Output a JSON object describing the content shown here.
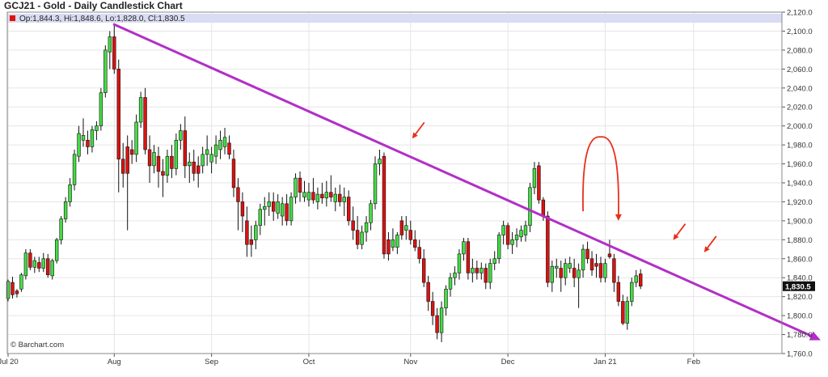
{
  "chart_data": {
    "type": "candlestick",
    "title": "GCJ21 - Gold - Daily Candlestick Chart",
    "ohlc": {
      "label": "Op:1,844.3, Hi:1,848.6, Lo:1,828.0, Cl:1,830.5"
    },
    "watermark": "© Barchart.com",
    "last_price_label": "1,830.5",
    "y_axis": {
      "min": 1760,
      "max": 2120,
      "tick_labels": [
        "2,120.0",
        "2,100.0",
        "2,080.0",
        "2,060.0",
        "2,040.0",
        "2,020.0",
        "2,000.0",
        "1,980.0",
        "1,960.0",
        "1,940.0",
        "1,920.0",
        "1,900.0",
        "1,880.0",
        "1,860.0",
        "1,840.0",
        "1,820.0",
        "1,800.0",
        "1,780.0",
        "1,760.0"
      ],
      "ticks": [
        2120,
        2100,
        2080,
        2060,
        2040,
        2020,
        2000,
        1980,
        1960,
        1940,
        1920,
        1900,
        1880,
        1860,
        1840,
        1820,
        1800,
        1780,
        1760
      ]
    },
    "x_axis": {
      "labels": [
        {
          "text": "Jul 20",
          "bar": 0
        },
        {
          "text": "Aug",
          "bar": 24
        },
        {
          "text": "Sep",
          "bar": 46
        },
        {
          "text": "Oct",
          "bar": 68
        },
        {
          "text": "Nov",
          "bar": 91
        },
        {
          "text": "Dec",
          "bar": 113
        },
        {
          "text": "Jan 21",
          "bar": 135
        },
        {
          "text": "Feb",
          "bar": 155
        }
      ]
    },
    "candles": [
      [
        1,
        1818,
        1838,
        1815,
        1836
      ],
      [
        0,
        1835,
        1841,
        1818,
        1822
      ],
      [
        0,
        1823,
        1828,
        1819,
        1826
      ],
      [
        1,
        1828,
        1845,
        1825,
        1843
      ],
      [
        1,
        1842,
        1870,
        1838,
        1866
      ],
      [
        0,
        1866,
        1870,
        1848,
        1851
      ],
      [
        1,
        1851,
        1862,
        1845,
        1858
      ],
      [
        0,
        1856,
        1862,
        1846,
        1850
      ],
      [
        1,
        1850,
        1866,
        1846,
        1860
      ],
      [
        0,
        1860,
        1865,
        1840,
        1843
      ],
      [
        1,
        1842,
        1860,
        1838,
        1858
      ],
      [
        1,
        1858,
        1882,
        1855,
        1880
      ],
      [
        1,
        1880,
        1905,
        1875,
        1902
      ],
      [
        1,
        1902,
        1925,
        1898,
        1920
      ],
      [
        1,
        1920,
        1945,
        1915,
        1938
      ],
      [
        1,
        1938,
        1975,
        1932,
        1970
      ],
      [
        1,
        1968,
        2000,
        1962,
        1992
      ],
      [
        1,
        1990,
        2008,
        1978,
        1985
      ],
      [
        0,
        1985,
        1995,
        1970,
        1978
      ],
      [
        1,
        1978,
        2000,
        1972,
        1996
      ],
      [
        1,
        1995,
        2005,
        1985,
        2000
      ],
      [
        1,
        2000,
        2040,
        1995,
        2035
      ],
      [
        1,
        2035,
        2085,
        2030,
        2080
      ],
      [
        1,
        2078,
        2100,
        2060,
        2094
      ],
      [
        0,
        2094,
        2108,
        2055,
        2060
      ],
      [
        0,
        2060,
        2070,
        1930,
        1965
      ],
      [
        0,
        1965,
        1982,
        1935,
        1950
      ],
      [
        0,
        1950,
        1990,
        1890,
        1978
      ],
      [
        0,
        1975,
        1985,
        1960,
        1970
      ],
      [
        1,
        1970,
        2012,
        1962,
        2004
      ],
      [
        1,
        2004,
        2036,
        1998,
        2030
      ],
      [
        0,
        2030,
        2040,
        1970,
        1975
      ],
      [
        0,
        1975,
        1990,
        1940,
        1958
      ],
      [
        1,
        1958,
        1980,
        1950,
        1972
      ],
      [
        0,
        1968,
        1978,
        1935,
        1952
      ],
      [
        0,
        1952,
        1965,
        1925,
        1948
      ],
      [
        1,
        1948,
        1975,
        1940,
        1968
      ],
      [
        0,
        1968,
        1980,
        1945,
        1955
      ],
      [
        1,
        1955,
        1992,
        1948,
        1985
      ],
      [
        1,
        1985,
        2002,
        1975,
        1995
      ],
      [
        0,
        1995,
        2010,
        1945,
        1958
      ],
      [
        1,
        1958,
        1972,
        1940,
        1962
      ],
      [
        0,
        1962,
        1975,
        1942,
        1950
      ],
      [
        0,
        1950,
        1968,
        1935,
        1958
      ],
      [
        1,
        1958,
        1978,
        1950,
        1970
      ],
      [
        1,
        1970,
        1990,
        1958,
        1975
      ],
      [
        1,
        1962,
        1978,
        1950,
        1970
      ],
      [
        1,
        1968,
        1990,
        1960,
        1980
      ],
      [
        1,
        1975,
        1995,
        1965,
        1985
      ],
      [
        1,
        1978,
        1998,
        1970,
        1988
      ],
      [
        0,
        1982,
        1990,
        1965,
        1970
      ],
      [
        0,
        1965,
        1975,
        1925,
        1935
      ],
      [
        0,
        1935,
        1945,
        1890,
        1920
      ],
      [
        0,
        1920,
        1930,
        1888,
        1905
      ],
      [
        0,
        1900,
        1915,
        1862,
        1875
      ],
      [
        0,
        1875,
        1895,
        1862,
        1880
      ],
      [
        1,
        1880,
        1900,
        1870,
        1895
      ],
      [
        1,
        1895,
        1918,
        1885,
        1912
      ],
      [
        1,
        1912,
        1925,
        1895,
        1915
      ],
      [
        1,
        1915,
        1930,
        1905,
        1920
      ],
      [
        0,
        1920,
        1930,
        1900,
        1910
      ],
      [
        1,
        1908,
        1928,
        1902,
        1920
      ],
      [
        1,
        1905,
        1925,
        1895,
        1918
      ],
      [
        0,
        1918,
        1928,
        1895,
        1900
      ],
      [
        1,
        1900,
        1930,
        1895,
        1925
      ],
      [
        1,
        1925,
        1950,
        1918,
        1945
      ],
      [
        0,
        1945,
        1952,
        1920,
        1930
      ],
      [
        1,
        1930,
        1942,
        1920,
        1925
      ],
      [
        1,
        1922,
        1940,
        1915,
        1930
      ],
      [
        0,
        1930,
        1945,
        1918,
        1922
      ],
      [
        1,
        1920,
        1935,
        1912,
        1928
      ],
      [
        0,
        1928,
        1940,
        1918,
        1924
      ],
      [
        1,
        1924,
        1942,
        1915,
        1930
      ],
      [
        0,
        1930,
        1948,
        1920,
        1925
      ],
      [
        1,
        1920,
        1935,
        1910,
        1928
      ],
      [
        0,
        1928,
        1938,
        1915,
        1920
      ],
      [
        1,
        1920,
        1935,
        1905,
        1925
      ],
      [
        0,
        1925,
        1932,
        1895,
        1900
      ],
      [
        0,
        1900,
        1915,
        1880,
        1890
      ],
      [
        0,
        1890,
        1905,
        1870,
        1875
      ],
      [
        1,
        1875,
        1895,
        1870,
        1888
      ],
      [
        1,
        1888,
        1905,
        1878,
        1898
      ],
      [
        1,
        1898,
        1922,
        1890,
        1918
      ],
      [
        1,
        1918,
        1968,
        1912,
        1960
      ],
      [
        1,
        1960,
        1975,
        1948,
        1965
      ],
      [
        0,
        1968,
        1972,
        1860,
        1865
      ],
      [
        0,
        1865,
        1888,
        1858,
        1880
      ],
      [
        1,
        1880,
        1892,
        1868,
        1872
      ],
      [
        1,
        1872,
        1888,
        1865,
        1885
      ],
      [
        0,
        1885,
        1905,
        1880,
        1900
      ],
      [
        1,
        1895,
        1905,
        1880,
        1890
      ],
      [
        0,
        1890,
        1900,
        1875,
        1880
      ],
      [
        0,
        1880,
        1890,
        1868,
        1872
      ],
      [
        0,
        1872,
        1880,
        1855,
        1860
      ],
      [
        0,
        1860,
        1870,
        1830,
        1835
      ],
      [
        0,
        1835,
        1842,
        1805,
        1815
      ],
      [
        0,
        1815,
        1825,
        1790,
        1800
      ],
      [
        0,
        1800,
        1808,
        1775,
        1782
      ],
      [
        1,
        1782,
        1815,
        1772,
        1808
      ],
      [
        1,
        1808,
        1832,
        1800,
        1828
      ],
      [
        1,
        1828,
        1845,
        1820,
        1840
      ],
      [
        1,
        1840,
        1852,
        1832,
        1845
      ],
      [
        1,
        1845,
        1870,
        1838,
        1865
      ],
      [
        1,
        1865,
        1882,
        1858,
        1878
      ],
      [
        0,
        1878,
        1882,
        1838,
        1845
      ],
      [
        1,
        1845,
        1860,
        1835,
        1850
      ],
      [
        0,
        1850,
        1858,
        1838,
        1845
      ],
      [
        1,
        1845,
        1856,
        1838,
        1850
      ],
      [
        0,
        1850,
        1855,
        1828,
        1835
      ],
      [
        1,
        1835,
        1860,
        1828,
        1855
      ],
      [
        1,
        1855,
        1868,
        1848,
        1860
      ],
      [
        1,
        1860,
        1888,
        1855,
        1885
      ],
      [
        1,
        1885,
        1900,
        1875,
        1895
      ],
      [
        0,
        1895,
        1898,
        1870,
        1875
      ],
      [
        1,
        1875,
        1888,
        1865,
        1880
      ],
      [
        1,
        1880,
        1892,
        1872,
        1885
      ],
      [
        1,
        1883,
        1895,
        1878,
        1890
      ],
      [
        1,
        1885,
        1900,
        1878,
        1895
      ],
      [
        1,
        1895,
        1940,
        1888,
        1935
      ],
      [
        1,
        1935,
        1962,
        1928,
        1955
      ],
      [
        0,
        1958,
        1962,
        1918,
        1922
      ],
      [
        0,
        1922,
        1925,
        1900,
        1905
      ],
      [
        0,
        1905,
        1910,
        1830,
        1835
      ],
      [
        1,
        1835,
        1858,
        1825,
        1852
      ],
      [
        1,
        1852,
        1860,
        1840,
        1850
      ],
      [
        0,
        1850,
        1858,
        1825,
        1840
      ],
      [
        1,
        1840,
        1860,
        1832,
        1855
      ],
      [
        1,
        1855,
        1862,
        1845,
        1850
      ],
      [
        0,
        1850,
        1860,
        1830,
        1840
      ],
      [
        1,
        1840,
        1855,
        1808,
        1848
      ],
      [
        1,
        1848,
        1875,
        1840,
        1870
      ],
      [
        0,
        1870,
        1878,
        1855,
        1860
      ],
      [
        0,
        1860,
        1868,
        1842,
        1848
      ],
      [
        0,
        1852,
        1865,
        1840,
        1855
      ],
      [
        0,
        1855,
        1862,
        1835,
        1840
      ],
      [
        1,
        1840,
        1860,
        1835,
        1855
      ],
      [
        0,
        1865,
        1880,
        1860,
        1862
      ],
      [
        0,
        1860,
        1865,
        1825,
        1835
      ],
      [
        0,
        1835,
        1842,
        1810,
        1815
      ],
      [
        0,
        1815,
        1822,
        1790,
        1792
      ],
      [
        1,
        1792,
        1820,
        1785,
        1815
      ],
      [
        1,
        1815,
        1840,
        1810,
        1835
      ],
      [
        1,
        1835,
        1848,
        1830,
        1842
      ],
      [
        0,
        1844,
        1849,
        1828,
        1831
      ]
    ],
    "trendline": {
      "from": {
        "bar": 24,
        "price": 2107
      },
      "to": {
        "bar": 155,
        "price": 1834
      }
    },
    "annotations": [
      {
        "type": "arrow",
        "bar": 91,
        "price": 1985,
        "direction": "down-left"
      },
      {
        "type": "arc",
        "from": {
          "bar": 130,
          "price": 1910
        },
        "peak": {
          "bar": 134,
          "price": 1968
        },
        "to": {
          "bar": 138,
          "price": 1900
        }
      },
      {
        "type": "arrow",
        "bar": 150,
        "price": 1878,
        "direction": "down-left"
      },
      {
        "type": "arrow",
        "bar": 157,
        "price": 1865,
        "direction": "down-left"
      }
    ],
    "colors": {
      "up": "#44dd44",
      "down": "#dd1111",
      "trendline": "#b22fc7",
      "annotation": "#e8301b",
      "ohlc_band": "#d9dcf2",
      "grid": "#e5e5e5",
      "last_price_bg": "#111111"
    }
  }
}
